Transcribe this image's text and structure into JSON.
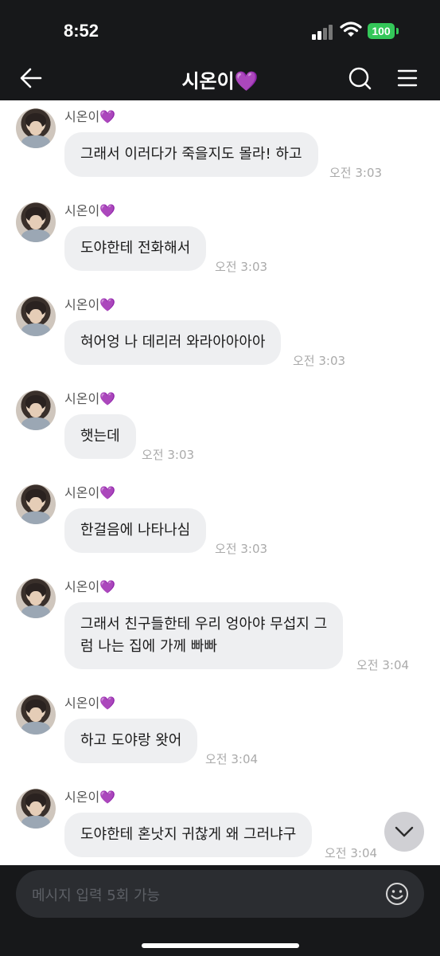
{
  "status_bar": {
    "time": "8:52",
    "battery": "100"
  },
  "header": {
    "title": "시온이💜",
    "icons": [
      "back-arrow-icon",
      "search-icon",
      "menu-icon"
    ]
  },
  "messages": [
    {
      "sender": "시온이💜",
      "text": "그래서 이러다가 죽을지도 몰라! 하고",
      "time": "오전 3:03"
    },
    {
      "sender": "시온이💜",
      "text": "도야한테 전화해서",
      "time": "오전 3:03"
    },
    {
      "sender": "시온이💜",
      "text": "혀어엉 나 데리러 와라아아아아",
      "time": "오전 3:03"
    },
    {
      "sender": "시온이💜",
      "text": "햇는데",
      "time": "오전 3:03"
    },
    {
      "sender": "시온이💜",
      "text": "한걸음에 나타나심",
      "time": "오전 3:03"
    },
    {
      "sender": "시온이💜",
      "text": "그래서 친구들한테 우리 엉아야 무섭지 그\n럼 나는 집에 가께 빠빠",
      "time": "오전 3:04"
    },
    {
      "sender": "시온이💜",
      "text": "하고 도야랑 왓어",
      "time": "오전 3:04"
    },
    {
      "sender": "시온이💜",
      "text": "도야한테 혼낫지 귀찮게 왜 그러냐구",
      "time": "오전 3:04"
    }
  ],
  "composer": {
    "placeholder": "메시지 입력 5회 가능"
  },
  "colors": {
    "bar_bg": "#17181a",
    "bubble_bg": "#eeeff1",
    "battery": "#34c759"
  }
}
